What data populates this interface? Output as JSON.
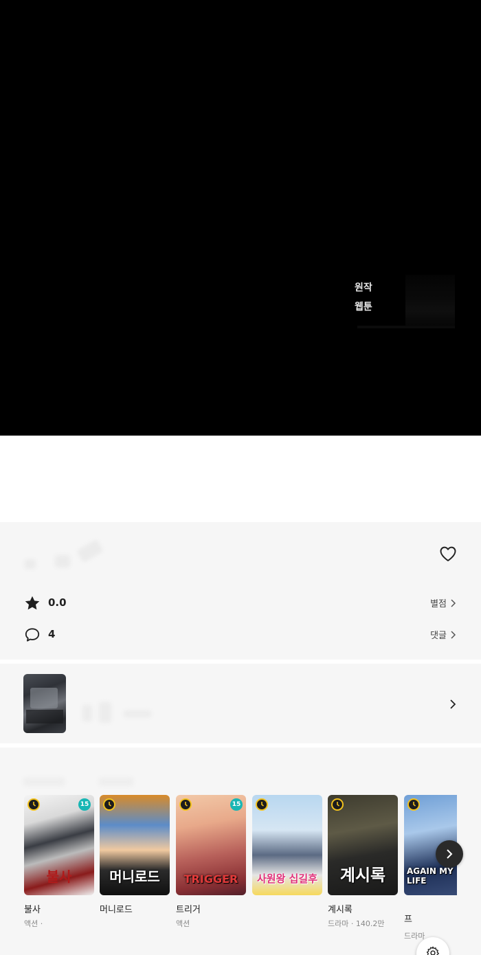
{
  "player": {
    "original_badge": [
      "원작",
      "웹툰"
    ]
  },
  "info": {
    "rating_value": "0.0",
    "rating_link": "별점",
    "comment_count": "4",
    "comment_link": "댓글"
  },
  "recommendations": {
    "items": [
      {
        "title": "불사",
        "meta": "액션 ·",
        "age": "15",
        "logo": "불사"
      },
      {
        "title": "머니로드",
        "meta": "",
        "age": "",
        "logo": "머니로드"
      },
      {
        "title": "트리거",
        "meta": "액션",
        "age": "15",
        "logo": "TRIGGER"
      },
      {
        "title": "",
        "meta": "",
        "age": "",
        "logo": "사원왕 십길후"
      },
      {
        "title": "계시록",
        "meta": "드라마 · 140.2만",
        "age": "",
        "logo": "계시록"
      },
      {
        "title": "프",
        "meta": "드라마",
        "age": "",
        "logo": "AGAIN MY LIFE"
      }
    ]
  },
  "icons": {
    "heart": "heart-outline-icon",
    "star": "star-filled-icon",
    "comment": "comment-bubble-icon",
    "chevron": "chevron-right-icon",
    "clock": "clock-badge-icon",
    "next": "carousel-next-icon",
    "settings": "gear-icon"
  },
  "colors": {
    "player_bg": "#000000",
    "panel_bg": "#f6f6f6",
    "age_badge": "#18b6b4",
    "clock_badge": "#f3c21d"
  }
}
